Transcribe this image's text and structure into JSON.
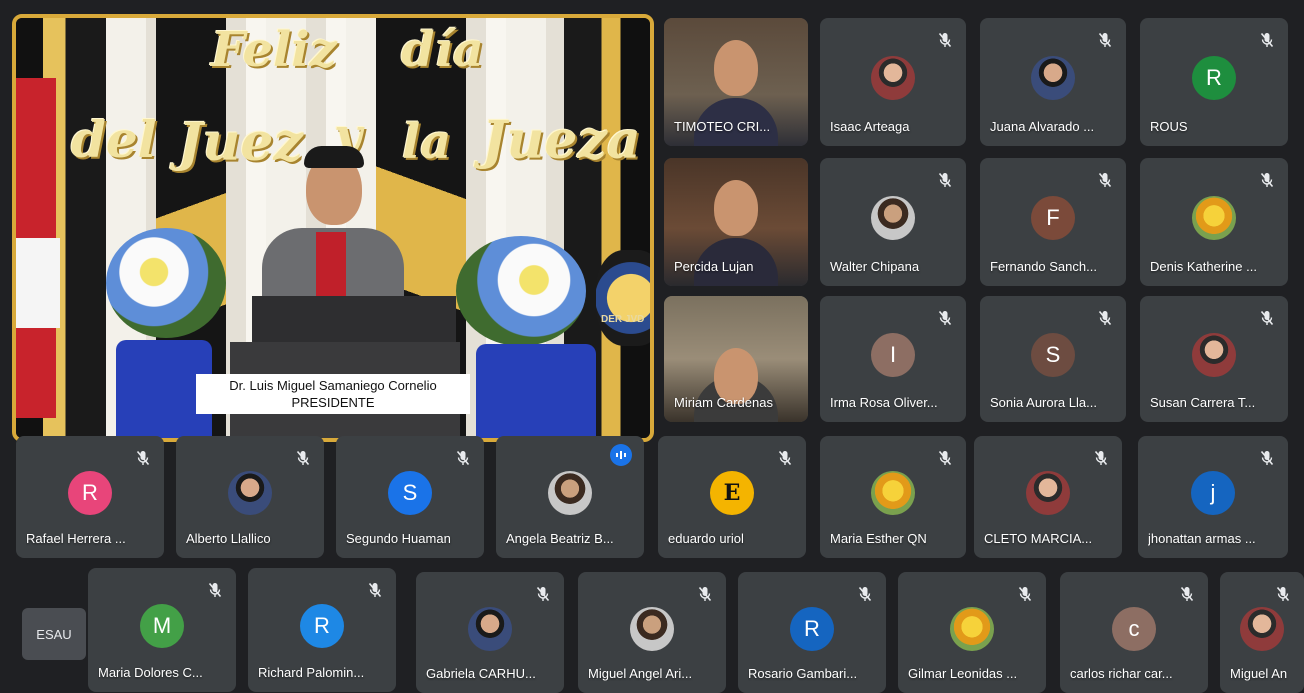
{
  "main_speaker": {
    "sign_line1_a": "Feliz",
    "sign_line1_b": "día",
    "sign_line2_a": "del",
    "sign_line2_b": "Juez",
    "sign_line2_c": "y",
    "sign_line2_d": "la",
    "sign_line2_e": "Jueza",
    "caption_name": "Dr. Luis Miguel Samaniego Cornelio",
    "caption_role": "PRESIDENTE",
    "banner_text": "DER JVD"
  },
  "participants": [
    {
      "name": "TIMOTEO CRI...",
      "type": "video"
    },
    {
      "name": "Isaac Arteaga",
      "type": "photo",
      "muted": true
    },
    {
      "name": "Juana Alvarado ...",
      "type": "photo",
      "muted": true
    },
    {
      "name": "ROUS",
      "type": "letter",
      "letter": "R",
      "color": "#1e8e3e",
      "muted": true
    },
    {
      "name": "Percida Lujan",
      "type": "video"
    },
    {
      "name": "Walter Chipana",
      "type": "photo",
      "muted": true
    },
    {
      "name": "Fernando Sanch...",
      "type": "letter",
      "letter": "F",
      "color": "#7b4a3a",
      "muted": true
    },
    {
      "name": "Denis Katherine ...",
      "type": "photo",
      "muted": true
    },
    {
      "name": "Miriam Cardenas",
      "type": "video"
    },
    {
      "name": "Irma Rosa Oliver...",
      "type": "letter",
      "letter": "I",
      "color": "#8d6e63",
      "muted": true
    },
    {
      "name": "Sonia Aurora Lla...",
      "type": "letter",
      "letter": "S",
      "color": "#6d4c41",
      "muted": true
    },
    {
      "name": "Susan Carrera T...",
      "type": "photo",
      "muted": true
    },
    {
      "name": "Rafael Herrera ...",
      "type": "letter",
      "letter": "R",
      "color": "#e8457a",
      "muted": true
    },
    {
      "name": "Alberto Llallico",
      "type": "photo",
      "muted": true
    },
    {
      "name": "Segundo Huaman",
      "type": "letter",
      "letter": "S",
      "color": "#1a73e8",
      "muted": true
    },
    {
      "name": "Angela Beatriz B...",
      "type": "photo",
      "muted": false,
      "speaking": true
    },
    {
      "name": "eduardo uriol",
      "type": "letter",
      "letter": "E",
      "color": "#f4b400",
      "muted": true
    },
    {
      "name": "Maria Esther QN",
      "type": "photo",
      "muted": true
    },
    {
      "name": "CLETO MARCIA...",
      "type": "photo",
      "muted": true
    },
    {
      "name": "jhonattan armas ...",
      "type": "letter",
      "letter": "j",
      "color": "#1565c0",
      "muted": true
    },
    {
      "name": "Maria Dolores C...",
      "type": "letter",
      "letter": "M",
      "color": "#43a047",
      "muted": true
    },
    {
      "name": "Richard Palomin...",
      "type": "letter",
      "letter": "R",
      "color": "#1e88e5",
      "muted": true
    },
    {
      "name": "Gabriela CARHU...",
      "type": "photo",
      "muted": true
    },
    {
      "name": "Miguel Angel Ari...",
      "type": "photo",
      "muted": true
    },
    {
      "name": "Rosario Gambari...",
      "type": "letter",
      "letter": "R",
      "color": "#1565c0",
      "muted": true
    },
    {
      "name": "Gilmar Leonidas ...",
      "type": "photo",
      "muted": true
    },
    {
      "name": "carlos richar car...",
      "type": "letter",
      "letter": "c",
      "color": "#8d6e63",
      "muted": true
    },
    {
      "name": "Miguel An",
      "type": "photo",
      "muted": true
    }
  ],
  "overflow_tile": {
    "label": "ESAU"
  },
  "colors": {
    "accent": "#d8a93a",
    "tile": "#3c4043",
    "background": "#1f2023"
  }
}
